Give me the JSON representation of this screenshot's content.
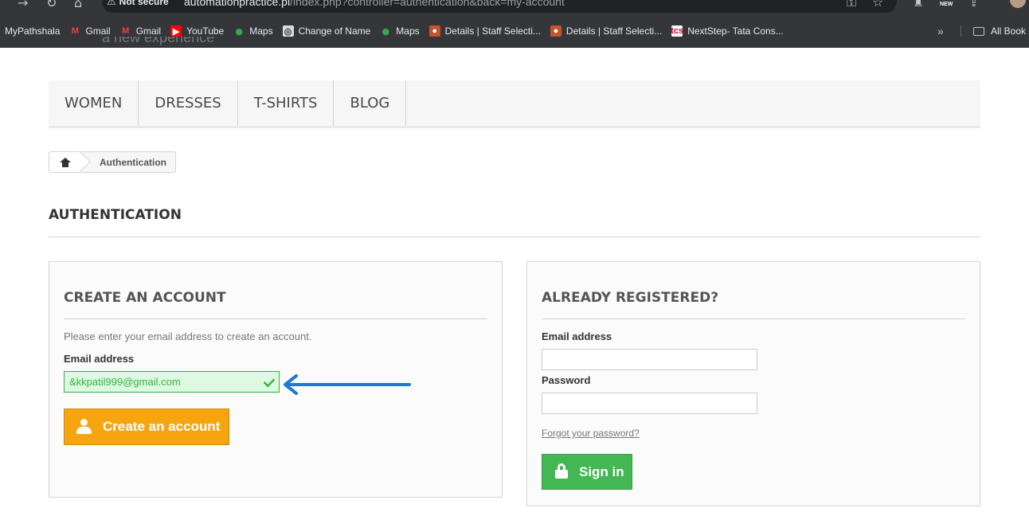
{
  "browser": {
    "security_label": "Not secure",
    "url_host": "automationpractice.pl",
    "url_path": "/index.php?controller=authentication&back=my-account",
    "new_badge": "NEW",
    "bookmarks": [
      {
        "label": "MyPathshala",
        "icon": ""
      },
      {
        "label": "Gmail",
        "icon": "gmail-icon"
      },
      {
        "label": "Gmail",
        "icon": "gmail-icon"
      },
      {
        "label": "YouTube",
        "icon": "youtube-icon"
      },
      {
        "label": "Maps",
        "icon": "maps-icon"
      },
      {
        "label": "Change of Name",
        "icon": "globe-icon"
      },
      {
        "label": "Maps",
        "icon": "maps-icon"
      },
      {
        "label": "Details | Staff Selecti...",
        "icon": "staff-icon"
      },
      {
        "label": "Details | Staff Selecti...",
        "icon": "staff-icon"
      },
      {
        "label": "NextStep- Tata Cons...",
        "icon": "tcs-icon"
      }
    ],
    "all_bookmarks": "All Book"
  },
  "site": {
    "tagline_fragment": "a new experience"
  },
  "menu": {
    "items": [
      "WOMEN",
      "DRESSES",
      "T-SHIRTS",
      "BLOG"
    ]
  },
  "breadcrumb": {
    "current": "Authentication"
  },
  "page": {
    "heading": "AUTHENTICATION"
  },
  "create_account": {
    "title": "CREATE AN ACCOUNT",
    "hint": "Please enter your email address to create an account.",
    "email_label": "Email address",
    "email_value": "&kkpatil999@gmail.com",
    "button_label": "Create an account"
  },
  "login": {
    "title": "ALREADY REGISTERED?",
    "email_label": "Email address",
    "password_label": "Password",
    "email_value": "",
    "password_value": "",
    "forgot_label": "Forgot your password?",
    "button_label": "Sign in"
  },
  "colors": {
    "accent_orange": "#f7a50f",
    "success_green": "#43b754",
    "valid_field_bg": "#ddf9e1",
    "annotation_arrow": "#1a7ad4"
  }
}
